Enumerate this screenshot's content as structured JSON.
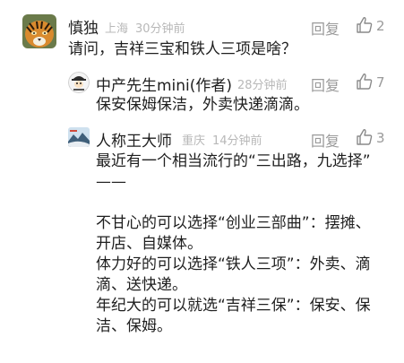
{
  "comments": [
    {
      "author": "慎独",
      "location": "上海",
      "time": "30分钟前",
      "reply_label": "回复",
      "likes": "2",
      "text": "请问，吉祥三宝和铁人三项是啥？",
      "avatar_icon": "tiger-avatar-icon"
    },
    {
      "author": "中产先生mini(作者)",
      "time": "28分钟前",
      "reply_label": "回复",
      "likes": "7",
      "text": "保安保姆保洁，外卖快递滴滴。",
      "avatar_icon": "cartoon-face-avatar-icon"
    },
    {
      "author": "人称王大师",
      "location": "重庆",
      "time": "14分钟前",
      "reply_label": "回复",
      "likes": "3",
      "lines": [
        "最近有一个相当流行的“三出路，九选择”",
        "——",
        "",
        "不甘心的可以选择“创业三部曲”：摆摊、",
        "开店、自媒体。",
        "体力好的可以选择“铁人三项”：外卖、滴",
        "滴、送快递。",
        "年纪大的可以就选“吉祥三保”：保安、保",
        "洁、保姆。"
      ],
      "avatar_icon": "landscape-avatar-icon"
    }
  ],
  "colors": {
    "text": "#1f1f1f",
    "meta": "#b8b8b8",
    "action": "#9a9a9a",
    "name_link": "#2a5aa8"
  }
}
